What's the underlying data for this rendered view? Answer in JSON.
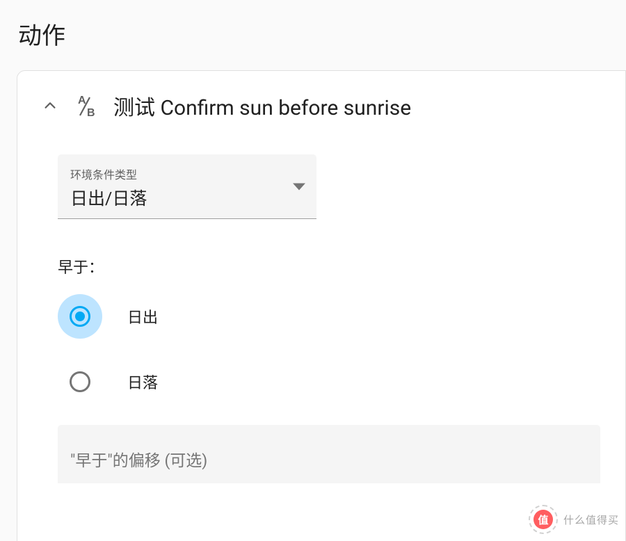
{
  "section": {
    "title": "动作"
  },
  "card": {
    "title": "测试 Confirm sun before sunrise",
    "select": {
      "label": "环境条件类型",
      "value": "日出/日落"
    },
    "radioGroup": {
      "label": "早于：",
      "options": [
        {
          "label": "日出",
          "selected": true
        },
        {
          "label": "日落",
          "selected": false
        }
      ]
    },
    "offsetField": {
      "placeholder": "\"早于\"的偏移 (可选)"
    }
  },
  "watermark": {
    "glyph": "值",
    "text": "什么值得买"
  }
}
